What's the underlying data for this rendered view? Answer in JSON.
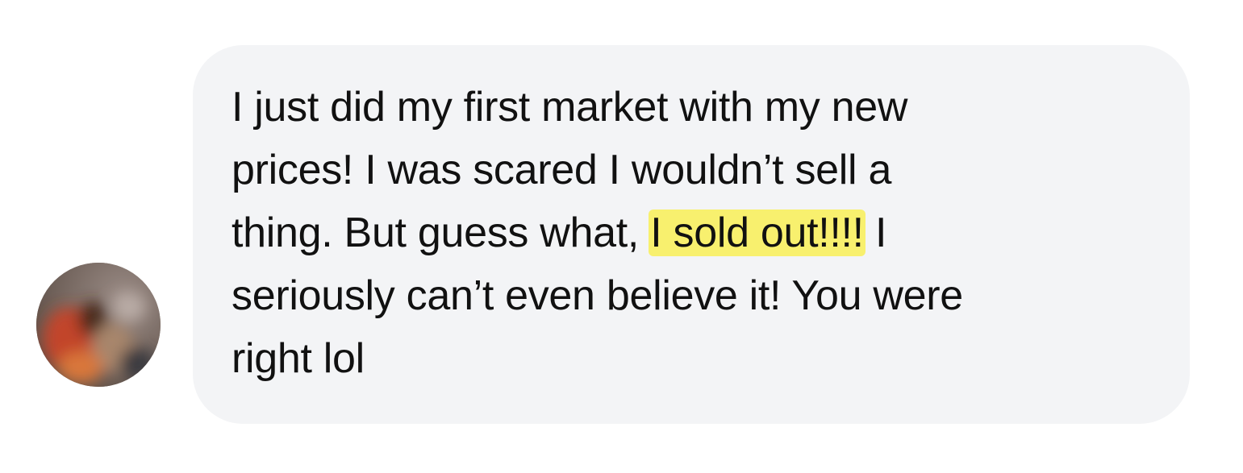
{
  "message": {
    "lines": {
      "l1": "I just did my first market with my new",
      "l2": "prices! I was scared I wouldn’t sell a",
      "l3_before": "thing. But guess what, ",
      "l3_highlight": "I sold out!!!!",
      "l3_after": " I",
      "l4": "seriously can’t even believe it! You were",
      "l5": "right lol"
    },
    "highlight_color": "#f8f06e",
    "bubble_color": "#f3f4f6"
  },
  "avatar": {
    "icon": "avatar-photo-blurred"
  }
}
